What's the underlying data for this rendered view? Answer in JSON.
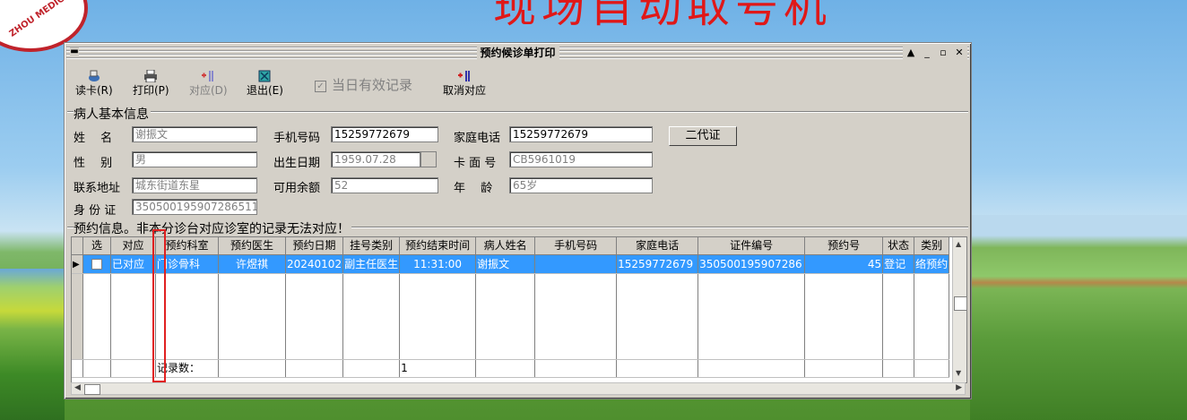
{
  "background": {
    "title_fragment": "现场自动取号机",
    "logo_text": "ZHOU MEDICAL"
  },
  "window": {
    "title": "预约候诊单打印",
    "controls": [
      "▲",
      "_",
      "▫",
      "✕"
    ]
  },
  "toolbar": {
    "read_card": "读卡(R)",
    "print": "打印(P)",
    "match": "对应(D)",
    "exit": "退出(E)",
    "today_valid": "当日有效记录",
    "cancel_match": "取消对应"
  },
  "patient": {
    "section_label": "病人基本信息",
    "name_label": "姓　 名",
    "name_value": "谢振文",
    "phone_label": "手机号码",
    "phone_value": "15259772679",
    "home_phone_label": "家庭电话",
    "home_phone_value": "15259772679",
    "id2_button": "二代证",
    "sex_label": "性　 别",
    "sex_value": "男",
    "birth_label": "出生日期",
    "birth_value": "1959.07.28",
    "card_label": "卡 面 号",
    "card_value": "CB5961019",
    "address_label": "联系地址",
    "address_value": "城东街道东星",
    "balance_label": "可用余额",
    "balance_value": "52",
    "age_label": "年　 龄",
    "age_value": "65岁",
    "id_label": "身 份 证",
    "id_value": "350500195907286511"
  },
  "appointment": {
    "section_label": "预约信息。非本分诊台对应诊室的记录无法对应！",
    "columns": [
      "选",
      "对应",
      "预约科室",
      "预约医生",
      "预约日期",
      "挂号类别",
      "预约结束时间",
      "病人姓名",
      "手机号码",
      "家庭电话",
      "证件编号",
      "预约号",
      "状态",
      "类别"
    ],
    "rows": [
      {
        "status_match": "已对应",
        "dept": "门诊骨科",
        "doctor": "许煜祺",
        "date": "20240102",
        "reg_type": "副主任医生",
        "end_time": "11:31:00",
        "patient": "谢振文",
        "mobile": "",
        "home_phone": "15259772679",
        "cert_no": "350500195907286",
        "appt_no": "45",
        "state": "登记",
        "kind": "络预约"
      }
    ],
    "footer_label": "记录数：",
    "footer_count": "1"
  }
}
